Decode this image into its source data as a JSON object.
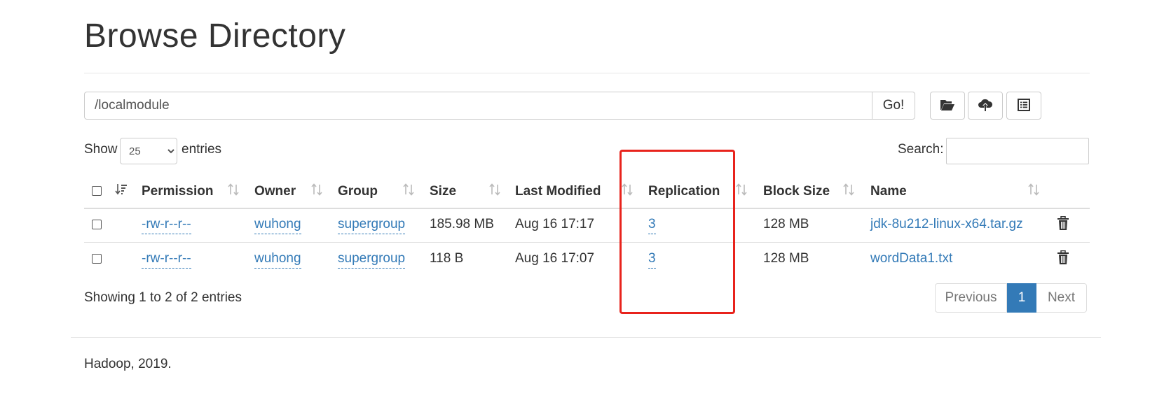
{
  "page": {
    "title": "Browse Directory"
  },
  "path_bar": {
    "value": "/localmodule",
    "go_label": "Go!"
  },
  "toolbar": {
    "icons": [
      "folder-open-icon",
      "cloud-upload-icon",
      "list-icon"
    ]
  },
  "table_controls": {
    "show_label": "Show",
    "entries_value": "25",
    "entries_label": "entries",
    "search_label": "Search:"
  },
  "table": {
    "columns": [
      "Permission",
      "Owner",
      "Group",
      "Size",
      "Last Modified",
      "Replication",
      "Block Size",
      "Name"
    ],
    "rows": [
      {
        "permission": "-rw-r--r--",
        "owner": "wuhong",
        "group": "supergroup",
        "size": "185.98 MB",
        "last_modified": "Aug 16 17:17",
        "replication": "3",
        "block_size": "128 MB",
        "name": "jdk-8u212-linux-x64.tar.gz"
      },
      {
        "permission": "-rw-r--r--",
        "owner": "wuhong",
        "group": "supergroup",
        "size": "118 B",
        "last_modified": "Aug 16 17:07",
        "replication": "3",
        "block_size": "128 MB",
        "name": "wordData1.txt"
      }
    ]
  },
  "pagination": {
    "info": "Showing 1 to 2 of 2 entries",
    "previous": "Previous",
    "current": "1",
    "next": "Next"
  },
  "annotation": {
    "color": "#e8231c"
  },
  "colors": {
    "link": "#337ab7",
    "active_page": "#337ab7"
  },
  "footer": {
    "text": "Hadoop, 2019."
  }
}
